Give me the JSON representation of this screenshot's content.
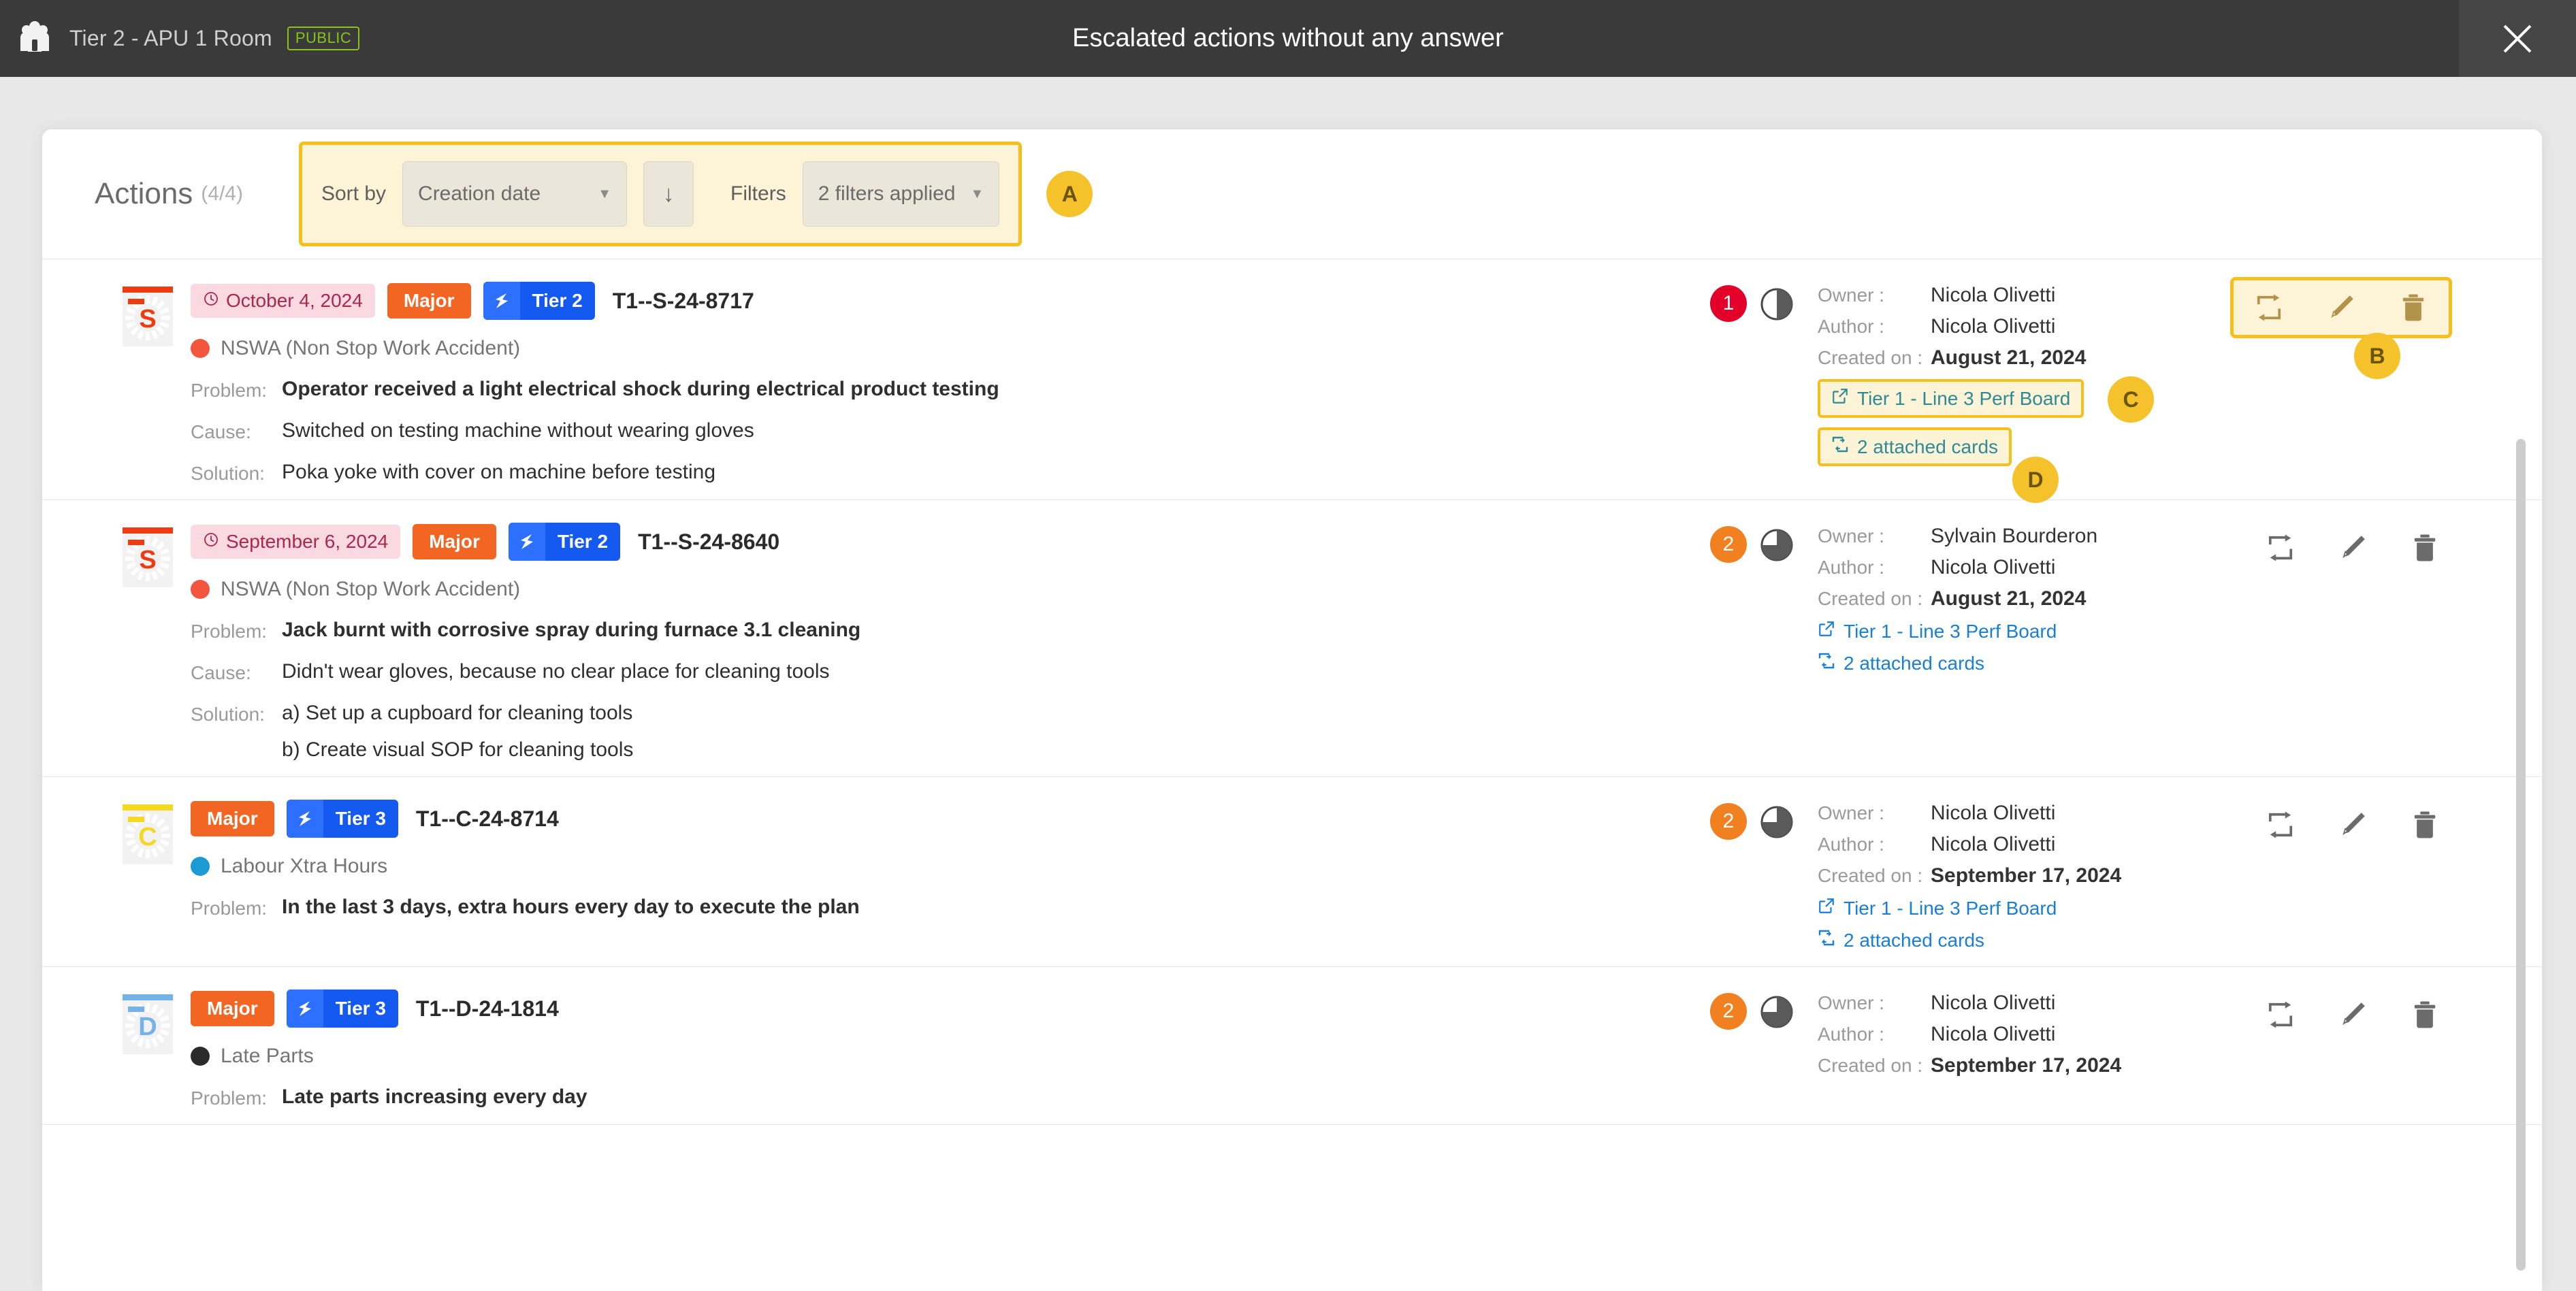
{
  "topbar": {
    "room_name": "Tier 2 - APU 1 Room",
    "visibility_badge": "PUBLIC",
    "title": "Escalated actions without any answer",
    "people_icon": "people-icon",
    "close_icon": "close-icon"
  },
  "panel": {
    "heading": "Actions",
    "count": "(4/4)",
    "toolbar": {
      "sort_label": "Sort by",
      "sort_value": "Creation date",
      "sort_caret": "▼",
      "direction_icon": "↓",
      "filters_label": "Filters",
      "filters_value": "2 filters applied",
      "filters_caret": "▼",
      "callout": "A"
    }
  },
  "callouts": {
    "b": "B",
    "c": "C",
    "d": "D"
  },
  "labels": {
    "problem": "Problem:",
    "cause": "Cause:",
    "solution": "Solution:",
    "owner": "Owner :",
    "author": "Author :",
    "created_on": "Created on :"
  },
  "icons": {
    "duplicate": "duplicate-icon",
    "edit": "edit-pencil-icon",
    "delete": "trash-icon",
    "external_link": "external-link-icon",
    "attached_cards": "attached-cards-icon",
    "clock": "clock-icon",
    "tier": "tier-lightning-icon",
    "progress": "progress-pie-icon"
  },
  "colors": {
    "accent_yellow": "#f7bf1e",
    "major_orange": "#f26522",
    "tier_blue": "#1459f0",
    "link_blue": "#1a7fd4",
    "link_teal": "#2d8a96",
    "date_pink_bg": "#fbd9e2",
    "date_pink_fg": "#a8294c",
    "count_red": "#e2002a",
    "count_orange": "#f08020",
    "public_green": "#86c516"
  },
  "rows": [
    {
      "tile": {
        "letter": "S",
        "color": "#ee3b11",
        "strip": "#ee3b11"
      },
      "date": "October 4, 2024",
      "severity": "Major",
      "tier": "Tier 2",
      "ref": "T1--S-24-8717",
      "category": {
        "name": "NSWA (Non Stop Work Accident)",
        "color": "#f2573d"
      },
      "problem": "Operator received a light electrical shock during electrical product testing",
      "cause": "Switched on testing machine without wearing gloves",
      "solution": [
        "Poka yoke with cover on machine before testing"
      ],
      "count": "1",
      "count_color": "#e2002a",
      "progress": 50,
      "owner": "Nicola Olivetti",
      "author": "Nicola Olivetti",
      "created_on": "August 21, 2024",
      "board_link": "Tier 1 - Line 3 Perf Board",
      "attached_cards": "2 attached cards",
      "highlighted": true
    },
    {
      "tile": {
        "letter": "S",
        "color": "#ee3b11",
        "strip": "#ee3b11"
      },
      "date": "September 6, 2024",
      "severity": "Major",
      "tier": "Tier 2",
      "ref": "T1--S-24-8640",
      "category": {
        "name": "NSWA (Non Stop Work Accident)",
        "color": "#f2573d"
      },
      "problem": "Jack burnt with corrosive spray during furnace 3.1 cleaning",
      "cause": "Didn't wear gloves, because no clear place for cleaning tools",
      "solution": [
        "a) Set up a cupboard for cleaning tools",
        "b) Create visual SOP for cleaning tools"
      ],
      "count": "2",
      "count_color": "#f08020",
      "progress": 75,
      "owner": "Sylvain Bourderon",
      "author": "Nicola Olivetti",
      "created_on": "August 21, 2024",
      "board_link": "Tier 1 - Line 3 Perf Board",
      "attached_cards": "2 attached cards",
      "highlighted": false
    },
    {
      "tile": {
        "letter": "C",
        "color": "#f5d821",
        "strip": "#f5d821"
      },
      "date": null,
      "severity": "Major",
      "tier": "Tier 3",
      "ref": "T1--C-24-8714",
      "category": {
        "name": "Labour Xtra Hours",
        "color": "#1c9ad6"
      },
      "problem": "In the last 3 days, extra hours every day to execute the plan",
      "cause": null,
      "solution": null,
      "count": "2",
      "count_color": "#f08020",
      "progress": 75,
      "owner": "Nicola Olivetti",
      "author": "Nicola Olivetti",
      "created_on": "September 17, 2024",
      "board_link": "Tier 1 - Line 3 Perf Board",
      "attached_cards": "2 attached cards",
      "highlighted": false
    },
    {
      "tile": {
        "letter": "D",
        "color": "#74b3ea",
        "strip": "#74b3ea"
      },
      "date": null,
      "severity": "Major",
      "tier": "Tier 3",
      "ref": "T1--D-24-1814",
      "category": {
        "name": "Late Parts",
        "color": "#2b2b2b"
      },
      "problem": "Late parts increasing every day",
      "cause": null,
      "solution": null,
      "count": "2",
      "count_color": "#f08020",
      "progress": 75,
      "owner": "Nicola Olivetti",
      "author": "Nicola Olivetti",
      "created_on": "September 17, 2024",
      "board_link": null,
      "attached_cards": null,
      "highlighted": false
    }
  ]
}
